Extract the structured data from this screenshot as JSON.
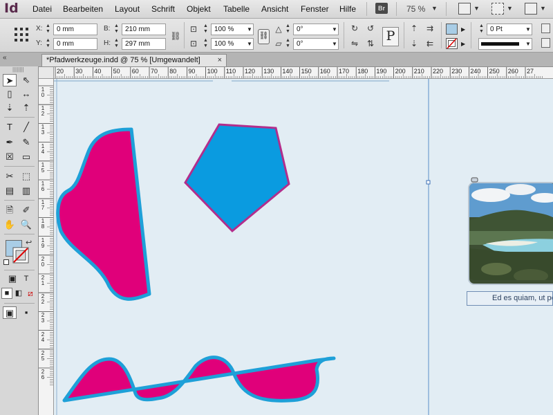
{
  "app": {
    "logo": "Id",
    "bridge_label": "Br",
    "zoom": "75 %"
  },
  "menu": [
    "Datei",
    "Bearbeiten",
    "Layout",
    "Schrift",
    "Objekt",
    "Tabelle",
    "Ansicht",
    "Fenster",
    "Hilfe"
  ],
  "control_panel": {
    "x_label": "X:",
    "x_value": "0 mm",
    "y_label": "Y:",
    "y_value": "0 mm",
    "w_label": "B:",
    "w_value": "210 mm",
    "h_label": "H:",
    "h_value": "297 mm",
    "scale_x": "100 %",
    "scale_y": "100 %",
    "rotation": "0°",
    "shear": "0°",
    "stroke_weight": "0 Pt",
    "fill_color": "#a9cde6"
  },
  "document_tab": {
    "title": "*Pfadwerkzeuge.indd @ 75 % [Umgewandelt]",
    "close": "×"
  },
  "ruler": {
    "horizontal": [
      "20",
      "30",
      "40",
      "50",
      "60",
      "70",
      "80",
      "90",
      "100",
      "110",
      "120",
      "130",
      "140",
      "150",
      "160",
      "170",
      "180",
      "190",
      "200",
      "210",
      "220",
      "230",
      "240",
      "250",
      "260",
      "27"
    ],
    "vertical": [
      "1 0",
      "1 2",
      "1 3",
      "1 4",
      "1 5",
      "1 6",
      "1 7",
      "1 8",
      "1 9",
      "2 0",
      "2 1",
      "2 2",
      "2 3",
      "2 4",
      "2 5",
      "2 6"
    ]
  },
  "canvas": {
    "caption": "Ed es quiam, ut pe",
    "shape_fill": "#e0007a",
    "shape_stroke": "#1ea0d8",
    "pentagon_fill": "#0a9be0",
    "pentagon_stroke": "#b22e8c",
    "background": "#e2edf4"
  }
}
